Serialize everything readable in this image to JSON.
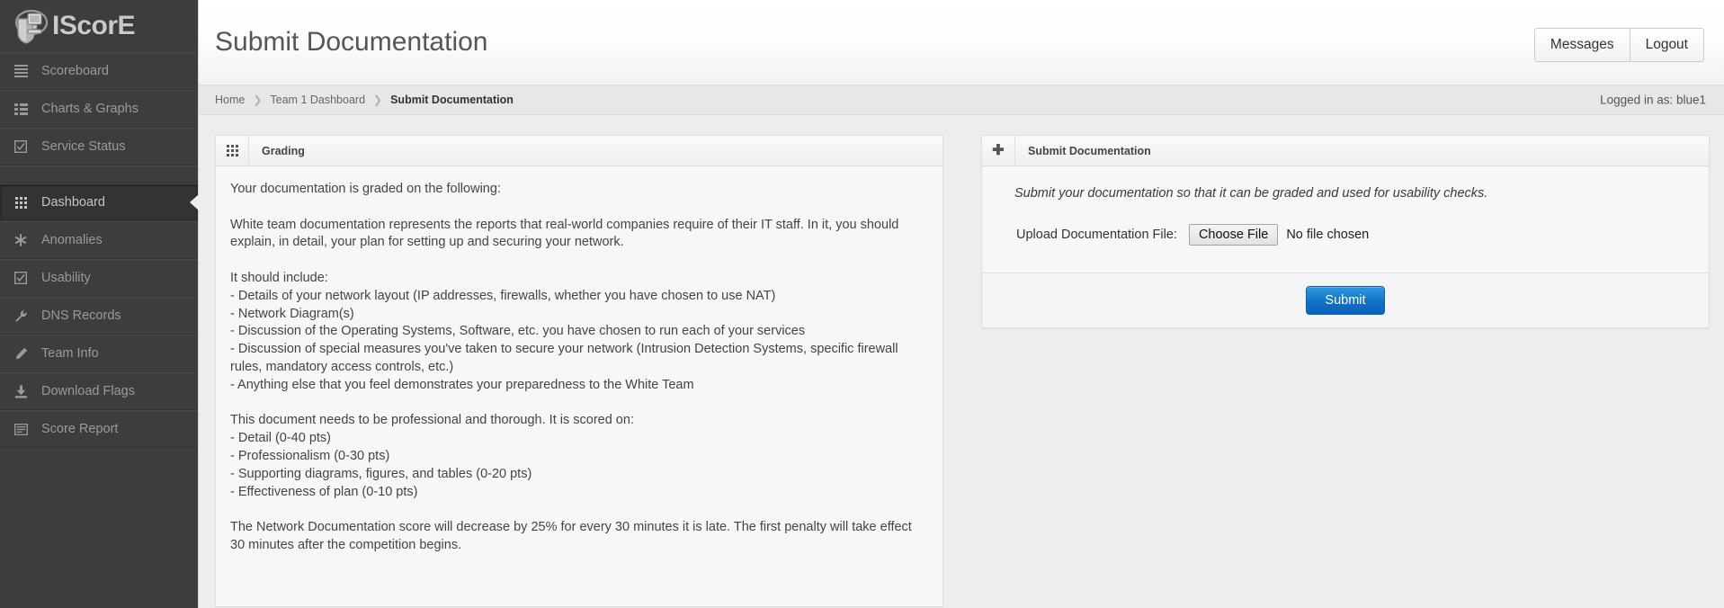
{
  "brand": {
    "name": "IScorE",
    "logo_icon": "shield-computer-logo"
  },
  "sidebar": {
    "items": [
      {
        "label": "Scoreboard",
        "icon": "list-icon",
        "active": false
      },
      {
        "label": "Charts & Graphs",
        "icon": "list-alt-icon",
        "active": false
      },
      {
        "label": "Service Status",
        "icon": "check-square-icon",
        "active": false
      },
      {
        "label": "Dashboard",
        "icon": "grid-icon",
        "active": true
      },
      {
        "label": "Anomalies",
        "icon": "asterisk-icon",
        "active": false
      },
      {
        "label": "Usability",
        "icon": "check-square-icon",
        "active": false
      },
      {
        "label": "DNS Records",
        "icon": "wrench-icon",
        "active": false
      },
      {
        "label": "Team Info",
        "icon": "pencil-icon",
        "active": false
      },
      {
        "label": "Download Flags",
        "icon": "download-icon",
        "active": false
      },
      {
        "label": "Score Report",
        "icon": "report-icon",
        "active": false
      }
    ]
  },
  "header": {
    "title": "Submit Documentation",
    "messages_label": "Messages",
    "logout_label": "Logout"
  },
  "breadcrumb": {
    "items": [
      "Home",
      "Team 1 Dashboard",
      "Submit Documentation"
    ],
    "separator": "❯",
    "logged_in_as": "Logged in as: blue1"
  },
  "grading_panel": {
    "header_icon": "grid-icon",
    "title": "Grading",
    "body": "Your documentation is graded on the following:\n\nWhite team documentation represents the reports that real-world companies require of their IT staff. In it, you should explain, in detail, your plan for setting up and securing your network.\n\nIt should include:\n- Details of your network layout (IP addresses, firewalls, whether you have chosen to use NAT)\n- Network Diagram(s)\n- Discussion of the Operating Systems, Software, etc. you have chosen to run each of your services\n- Discussion of special measures you've taken to secure your network (Intrusion Detection Systems, specific firewall rules, mandatory access controls, etc.)\n- Anything else that you feel demonstrates your preparedness to the White Team\n\nThis document needs to be professional and thorough. It is scored on:\n- Detail (0-40 pts)\n- Professionalism (0-30 pts)\n- Supporting diagrams, figures, and tables (0-20 pts)\n- Effectiveness of plan (0-10 pts)\n\nThe Network Documentation score will decrease by 25% for every 30 minutes it is late. The first penalty will take effect 30 minutes after the competition begins."
  },
  "submit_panel": {
    "header_icon": "plus-icon",
    "title": "Submit Documentation",
    "intro": "Submit your documentation so that it can be graded and used for usability checks.",
    "upload_label": "Upload Documentation File:",
    "choose_file_label": "Choose File",
    "no_file_text": "No file chosen",
    "submit_label": "Submit"
  },
  "colors": {
    "sidebar_bg": "#3d3d3d",
    "sidebar_active_bg": "#333333",
    "page_bg": "#ededed",
    "panel_bg": "#f7f7f7",
    "accent_blue": "#1372c6",
    "text": "#444444"
  }
}
